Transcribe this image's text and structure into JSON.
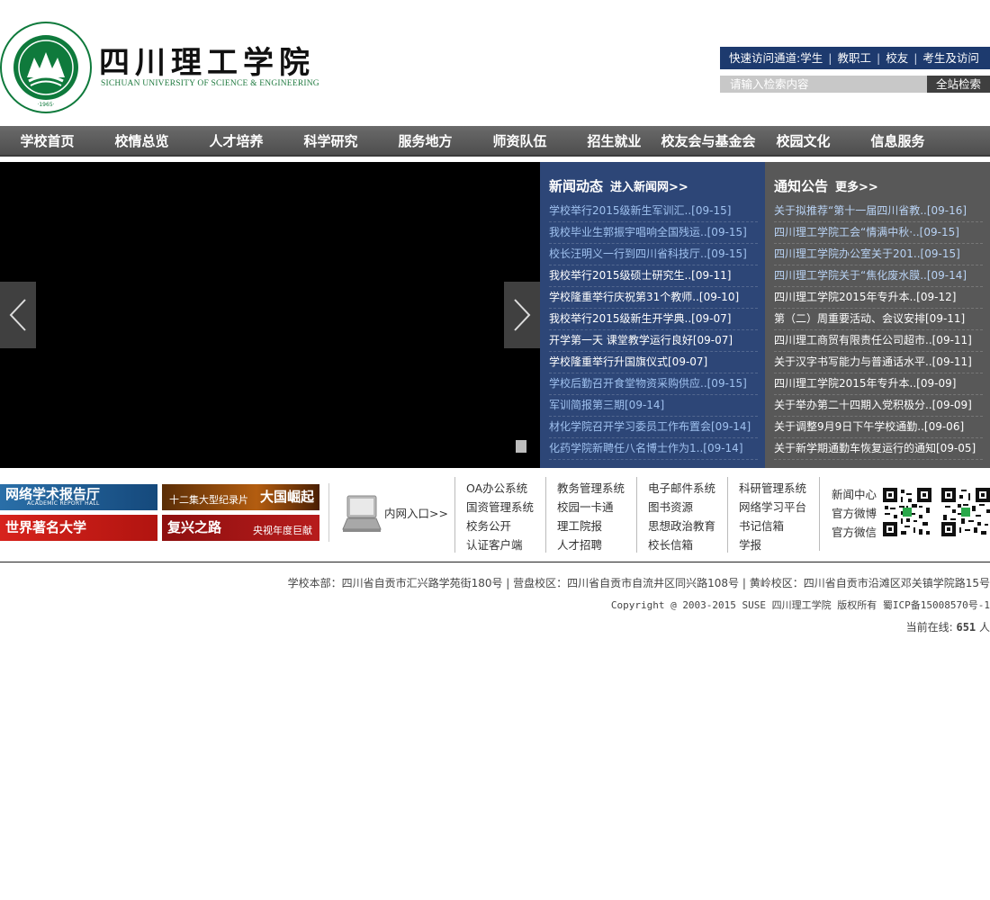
{
  "header": {
    "logo_cn": "四川理工学院",
    "logo_en": "SICHUAN UNIVERSITY OF SCIENCE & ENGINEERING",
    "emblem_ring_text_top": "四川理工学院",
    "emblem_ring_text_bottom": "SICHUAN UNIVERSITY OF SCIENCE & ENGINEERING",
    "emblem_year": "·1965·",
    "quick_access": {
      "title": "快速访问通道:",
      "links": [
        "学生",
        "教职工",
        "校友",
        "考生及访问"
      ]
    },
    "search": {
      "placeholder": "请输入检索内容",
      "button": "全站检索"
    }
  },
  "nav": [
    "学校首页",
    "校情总览",
    "人才培养",
    "科学研究",
    "服务地方",
    "师资队伍",
    "招生就业",
    "校友会与基金会",
    "校园文化",
    "信息服务"
  ],
  "news": {
    "title": "新闻动态",
    "more": "进入新闻网>>",
    "items": [
      "学校举行2015级新生军训汇..[09-15]",
      "我校毕业生郭振宇唱响全国残运..[09-15]",
      "校长汪明义一行到四川省科技厅..[09-15]",
      "我校举行2015级硕士研究生..[09-11]",
      "学校隆重举行庆祝第31个教师..[09-10]",
      "我校举行2015级新生开学典..[09-07]",
      "开学第一天 课堂教学运行良好[09-07]",
      "学校隆重举行升国旗仪式[09-07]",
      "学校后勤召开食堂物资采购供应..[09-15]",
      "军训简报第三期[09-14]",
      "材化学院召开学习委员工作布置会[09-14]",
      "化药学院新聘任八名博士作为1..[09-14]"
    ]
  },
  "notices": {
    "title": "通知公告",
    "more": "更多>>",
    "items": [
      "关于拟推荐“第十一届四川省教..[09-16]",
      "四川理工学院工会“情满中秋·..[09-15]",
      "四川理工学院办公室关于201..[09-15]",
      "四川理工学院关于“焦化废水膜..[09-14]",
      "四川理工学院2015年专升本..[09-12]",
      "第（二）周重要活动、会议安排[09-11]",
      "四川理工商贸有限责任公司超市..[09-11]",
      "关于汉字书写能力与普通话水平..[09-11]",
      "四川理工学院2015年专升本..[09-09]",
      "关于举办第二十四期入党积极分..[09-09]",
      "关于调整9月9日下午学校通勤..[09-06]",
      "关于新学期通勤车恢复运行的通知[09-05]"
    ]
  },
  "banners": {
    "report_main": "网络学术报告厅",
    "report_sub": "ACADEMIC REPORT HALL",
    "daguo_left": "十二集大型纪录片",
    "daguo_right": "大国崛起",
    "shijie": "世界著名大学",
    "fuxing_main": "复兴之路",
    "fuxing_sub": "央视年度巨献"
  },
  "intranet_label": "内网入口>>",
  "systems": [
    [
      "OA办公系统",
      "国资管理系统",
      "校务公开",
      "认证客户端"
    ],
    [
      "教务管理系统",
      "校园一卡通",
      "理工院报",
      "人才招聘"
    ],
    [
      "电子邮件系统",
      "图书资源",
      "思想政治教育",
      "校长信箱"
    ],
    [
      "科研管理系统",
      "网络学习平台",
      "书记信箱",
      "学报"
    ]
  ],
  "media_links": [
    "新闻中心",
    "官方微博",
    "官方微信"
  ],
  "footer": {
    "address": "学校本部：四川省自贡市汇兴路学苑街180号 | 营盘校区：四川省自贡市自流井区同兴路108号 | 黄岭校区：四川省自贡市沿滩区邓关镇学院路15号",
    "copyright": "Copyright @ 2003-2015 SUSE 四川理工学院 版权所有 蜀ICP备15008570号-1",
    "online_prefix": "当前在线:",
    "online_count": "651",
    "online_suffix": "人"
  },
  "colors": {
    "brand_green": "#0f7a3c",
    "quick_bar": "#1d3a6e",
    "nav_bg": "#5a5a5a",
    "news_bg": "#2d4677",
    "notice_bg": "#585858"
  }
}
